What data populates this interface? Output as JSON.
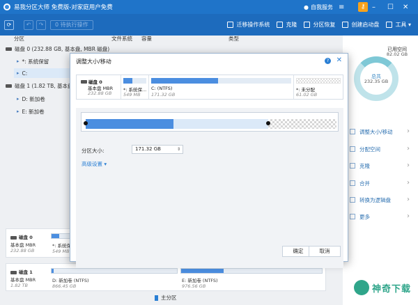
{
  "titlebar": {
    "title": "易我分区大师 免费版-对家庭用户免费",
    "login": "自我服务"
  },
  "toolbar": {
    "refresh": "⟳",
    "undo": "↶",
    "redo": "↷",
    "pending_ops": "0 待执行操作",
    "tools": [
      {
        "label": "迁移操作系统"
      },
      {
        "label": "克隆"
      },
      {
        "label": "分区恢复"
      },
      {
        "label": "创建启动盘"
      },
      {
        "label": "工具 ▾"
      }
    ]
  },
  "columns": {
    "partition": "分区",
    "filesystem": "文件系统",
    "capacity": "容量",
    "type": "类型"
  },
  "tree": {
    "disk0": "磁盘 0 (232.88 GB, 基本盘, MBR 磁盘)",
    "disk0_p1": "*: 系统保留",
    "disk0_p2": "C:",
    "disk1": "磁盘 1 (1.82 TB, 基本盘, MBR",
    "disk1_p1": "D: 新加卷",
    "disk1_p2": "E: 新加卷"
  },
  "rightpanel": {
    "used_label": "已用空间",
    "used_value": "82.02 GB",
    "total_label": "总共",
    "total_value": "232.35 GB",
    "ops": [
      "调整大小/移动",
      "分配空间",
      "克隆",
      "合并",
      "转换为逻辑盘",
      "更多"
    ]
  },
  "cards": {
    "disk0": {
      "name": "磁盘 0",
      "type": "基本盘 MBR",
      "size": "232.88 GB",
      "p1_label": "*: 系统保留",
      "p1_size": "549 MB"
    },
    "disk1": {
      "name": "磁盘 1",
      "type": "基本盘 MBR",
      "size": "1.82 TB",
      "p1_label": "D: 新加卷 (NTFS)",
      "p1_size": "866.45 GB",
      "p2_label": "E: 新加卷 (NTFS)",
      "p2_size": "976.56 GB"
    }
  },
  "dialog": {
    "title": "调整大小/移动",
    "help": "?",
    "close": "✕",
    "disk": {
      "name": "磁盘 0",
      "type": "基本盘 MBR",
      "size": "232.88 GB"
    },
    "segments": [
      {
        "label": "*: 系统保...",
        "size": "549 MB",
        "fill": 0.4
      },
      {
        "label": "C: (NTFS)",
        "size": "171.32 GB",
        "fill": 0.48
      },
      {
        "label": "*: 未分配",
        "size": "61.02 GB",
        "fill": 0
      }
    ],
    "resize": {
      "used_fraction": 0.48
    },
    "field_label": "分区大小:",
    "field_value": "171.32 GB",
    "advanced": "高级设置 ▾",
    "ok": "确定",
    "cancel": "取消"
  },
  "legend": {
    "primary": "主分区"
  },
  "watermark": {
    "text": "神奇下载"
  }
}
